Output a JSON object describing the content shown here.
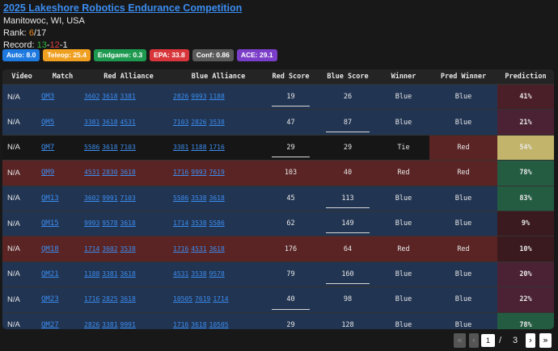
{
  "event": {
    "title": "2025 Lakeshore Robotics Endurance Competition",
    "location": "Manitowoc, WI, USA",
    "rank_label": "Rank:",
    "rank": "6",
    "rank_total": "/17",
    "record_label": "Record:",
    "record_wins": "13",
    "record_losses": "12",
    "record_ties": "1",
    "sep": "-"
  },
  "badges": [
    {
      "label": "Auto: 8.0",
      "color": "#1f7ae0"
    },
    {
      "label": "Teleop: 25.4",
      "color": "#f0a020"
    },
    {
      "label": "Endgame: 0.3",
      "color": "#1e9a50"
    },
    {
      "label": "EPA: 33.8",
      "color": "#d8363a"
    },
    {
      "label": "Conf: 0.86",
      "color": "#5a5a5a"
    },
    {
      "label": "ACE: 29.1",
      "color": "#7b3ec8"
    }
  ],
  "columns": {
    "video": "Video",
    "match": "Match",
    "red": "Red Alliance",
    "blue": "Blue Alliance",
    "red_score": "Red Score",
    "blue_score": "Blue Score",
    "winner": "Winner",
    "pred_winner": "Pred Winner",
    "prediction": "Prediction"
  },
  "rows": [
    {
      "video": "N/A",
      "match": "QM3",
      "red": [
        "3602",
        "3618",
        "3381"
      ],
      "blue": [
        "2826",
        "9993",
        "1188"
      ],
      "red_score": "19",
      "blue_score": "26",
      "winner": "Blue",
      "pred": "Blue",
      "prob": "41%",
      "row_bg": "#213452",
      "pred_bg": "#213452",
      "prob_bg": "#4a1f28",
      "ul": "red"
    },
    {
      "video": "N/A",
      "match": "QM5",
      "red": [
        "3381",
        "3618",
        "4531"
      ],
      "blue": [
        "7103",
        "2826",
        "3538"
      ],
      "red_score": "47",
      "blue_score": "87",
      "winner": "Blue",
      "pred": "Blue",
      "prob": "21%",
      "row_bg": "#213452",
      "pred_bg": "#213452",
      "prob_bg": "#4a2233",
      "ul": "blue"
    },
    {
      "video": "N/A",
      "match": "QM7",
      "red": [
        "5586",
        "3618",
        "7103"
      ],
      "blue": [
        "3381",
        "1188",
        "1716"
      ],
      "red_score": "29",
      "blue_score": "29",
      "winner": "Tie",
      "pred": "Red",
      "prob": "54%",
      "row_bg": "#161616",
      "pred_bg": "#5a2424",
      "prob_bg": "#c2b46a",
      "ul": "red"
    },
    {
      "video": "N/A",
      "match": "QM9",
      "red": [
        "4531",
        "2830",
        "3618"
      ],
      "blue": [
        "1716",
        "9993",
        "7619"
      ],
      "red_score": "103",
      "blue_score": "40",
      "winner": "Red",
      "pred": "Red",
      "prob": "78%",
      "row_bg": "#5a2424",
      "pred_bg": "#5a2424",
      "prob_bg": "#245c42",
      "ul": ""
    },
    {
      "video": "N/A",
      "match": "QM13",
      "red": [
        "3602",
        "9991",
        "7103"
      ],
      "blue": [
        "5586",
        "3538",
        "3618"
      ],
      "red_score": "45",
      "blue_score": "113",
      "winner": "Blue",
      "pred": "Blue",
      "prob": "83%",
      "row_bg": "#213452",
      "pred_bg": "#213452",
      "prob_bg": "#245c42",
      "ul": "blue"
    },
    {
      "video": "N/A",
      "match": "QM15",
      "red": [
        "9993",
        "9578",
        "3618"
      ],
      "blue": [
        "1714",
        "3538",
        "5586"
      ],
      "red_score": "62",
      "blue_score": "149",
      "winner": "Blue",
      "pred": "Blue",
      "prob": "9%",
      "row_bg": "#213452",
      "pred_bg": "#213452",
      "prob_bg": "#3a1a1e",
      "ul": "blue"
    },
    {
      "video": "N/A",
      "match": "QM18",
      "red": [
        "1714",
        "3602",
        "3538"
      ],
      "blue": [
        "1716",
        "4531",
        "3618"
      ],
      "red_score": "176",
      "blue_score": "64",
      "winner": "Red",
      "pred": "Red",
      "prob": "10%",
      "row_bg": "#5a2424",
      "pred_bg": "#5a2424",
      "prob_bg": "#3a1a1e",
      "ul": ""
    },
    {
      "video": "N/A",
      "match": "QM21",
      "red": [
        "1188",
        "3381",
        "3618"
      ],
      "blue": [
        "4531",
        "3538",
        "9578"
      ],
      "red_score": "79",
      "blue_score": "160",
      "winner": "Blue",
      "pred": "Blue",
      "prob": "20%",
      "row_bg": "#213452",
      "pred_bg": "#213452",
      "prob_bg": "#4a2233",
      "ul": "blue"
    },
    {
      "video": "N/A",
      "match": "QM23",
      "red": [
        "1716",
        "2825",
        "3618"
      ],
      "blue": [
        "10505",
        "7619",
        "1714"
      ],
      "red_score": "40",
      "blue_score": "98",
      "winner": "Blue",
      "pred": "Blue",
      "prob": "22%",
      "row_bg": "#213452",
      "pred_bg": "#213452",
      "prob_bg": "#4a2233",
      "ul": "red"
    },
    {
      "video": "N/A",
      "match": "QM27",
      "red": [
        "2826",
        "3381",
        "9991"
      ],
      "blue": [
        "1716",
        "3618",
        "10505"
      ],
      "red_score": "29",
      "blue_score": "128",
      "winner": "Blue",
      "pred": "Blue",
      "prob": "78%",
      "row_bg": "#213452",
      "pred_bg": "#213452",
      "prob_bg": "#245c42",
      "ul": "blue"
    }
  ],
  "pagination": {
    "first": "«",
    "prev": "‹",
    "current": "1",
    "sep": "/",
    "total": "3",
    "next": "›",
    "last": "»"
  }
}
